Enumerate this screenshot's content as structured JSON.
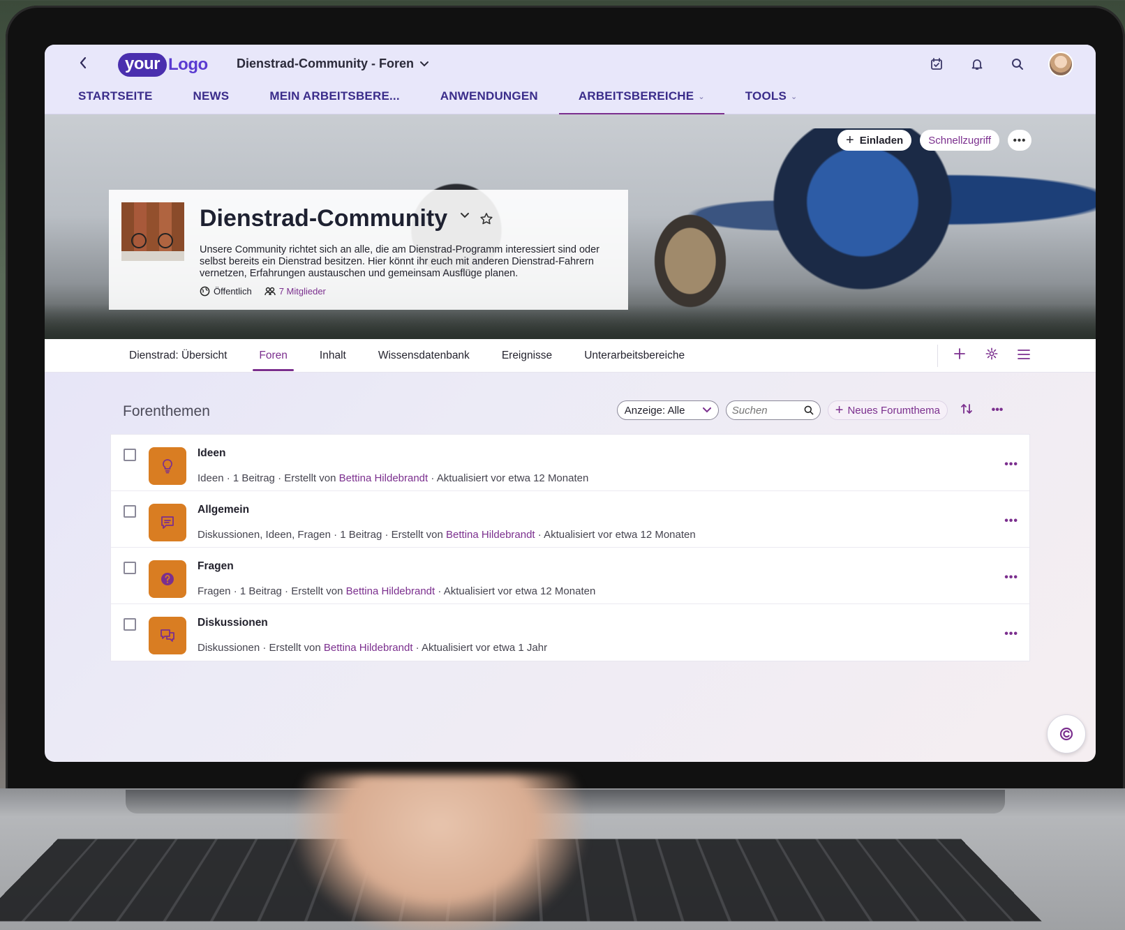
{
  "header": {
    "logo": {
      "part1": "your",
      "part2": "Logo"
    },
    "context_title": "Dienstrad-Community - Foren",
    "icons": [
      "back-icon",
      "saved-items-icon",
      "bell-icon",
      "search-icon",
      "avatar"
    ]
  },
  "main_nav": [
    {
      "label": "STARTSEITE",
      "has_dropdown": false,
      "active": false
    },
    {
      "label": "NEWS",
      "has_dropdown": false,
      "active": false
    },
    {
      "label": "MEIN ARBEITSBERE...",
      "has_dropdown": false,
      "active": false
    },
    {
      "label": "ANWENDUNGEN",
      "has_dropdown": false,
      "active": false
    },
    {
      "label": "ARBEITSBEREICHE",
      "has_dropdown": true,
      "active": true
    },
    {
      "label": "TOOLS",
      "has_dropdown": true,
      "active": false
    }
  ],
  "hero": {
    "invite_label": "Einladen",
    "quick_access_label": "Schnellzugriff",
    "title": "Dienstrad-Community",
    "description": "Unsere Community richtet sich an alle, die am Dienstrad-Programm interessiert sind oder selbst bereits ein Dienstrad besitzen. Hier könnt ihr euch mit anderen Dienstrad-Fahrern vernetzen, Erfahrungen austauschen und gemeinsam Ausflüge planen.",
    "visibility": "Öffentlich",
    "members": "7 Mitglieder"
  },
  "sub_nav": {
    "items": [
      {
        "label": "Dienstrad: Übersicht",
        "active": false
      },
      {
        "label": "Foren",
        "active": true
      },
      {
        "label": "Inhalt",
        "active": false
      },
      {
        "label": "Wissensdatenbank",
        "active": false
      },
      {
        "label": "Ereignisse",
        "active": false
      },
      {
        "label": "Unterarbeitsbereiche",
        "active": false
      }
    ],
    "tools": [
      "plus-icon",
      "gear-icon",
      "menu-icon"
    ]
  },
  "forum": {
    "section_title": "Forenthemen",
    "filter_label": "Anzeige: Alle",
    "search_placeholder": "Suchen",
    "new_topic_label": "Neues Forumthema",
    "topics": [
      {
        "title": "Ideen",
        "icon": "lightbulb-icon",
        "meta_prefix": "Ideen · 1 Beitrag · Erstellt von ",
        "author": "Bettina Hildebrandt",
        "meta_suffix": " · Aktualisiert vor etwa 12 Monaten"
      },
      {
        "title": "Allgemein",
        "icon": "comment-icon",
        "meta_prefix": "Diskussionen, Ideen, Fragen · 1 Beitrag · Erstellt von ",
        "author": "Bettina Hildebrandt",
        "meta_suffix": " · Aktualisiert vor etwa 12 Monaten"
      },
      {
        "title": "Fragen",
        "icon": "question-icon",
        "meta_prefix": "Fragen · 1 Beitrag · Erstellt von ",
        "author": "Bettina Hildebrandt",
        "meta_suffix": " · Aktualisiert vor etwa 12 Monaten"
      },
      {
        "title": "Diskussionen",
        "icon": "discussion-icon",
        "meta_prefix": "Diskussionen · Erstellt von ",
        "author": "Bettina Hildebrandt",
        "meta_suffix": " · Aktualisiert vor etwa 1 Jahr"
      }
    ]
  },
  "colors": {
    "accent": "#7b2f8e",
    "nav_text": "#3a2c8a",
    "topic_icon_bg": "#d97d22"
  }
}
